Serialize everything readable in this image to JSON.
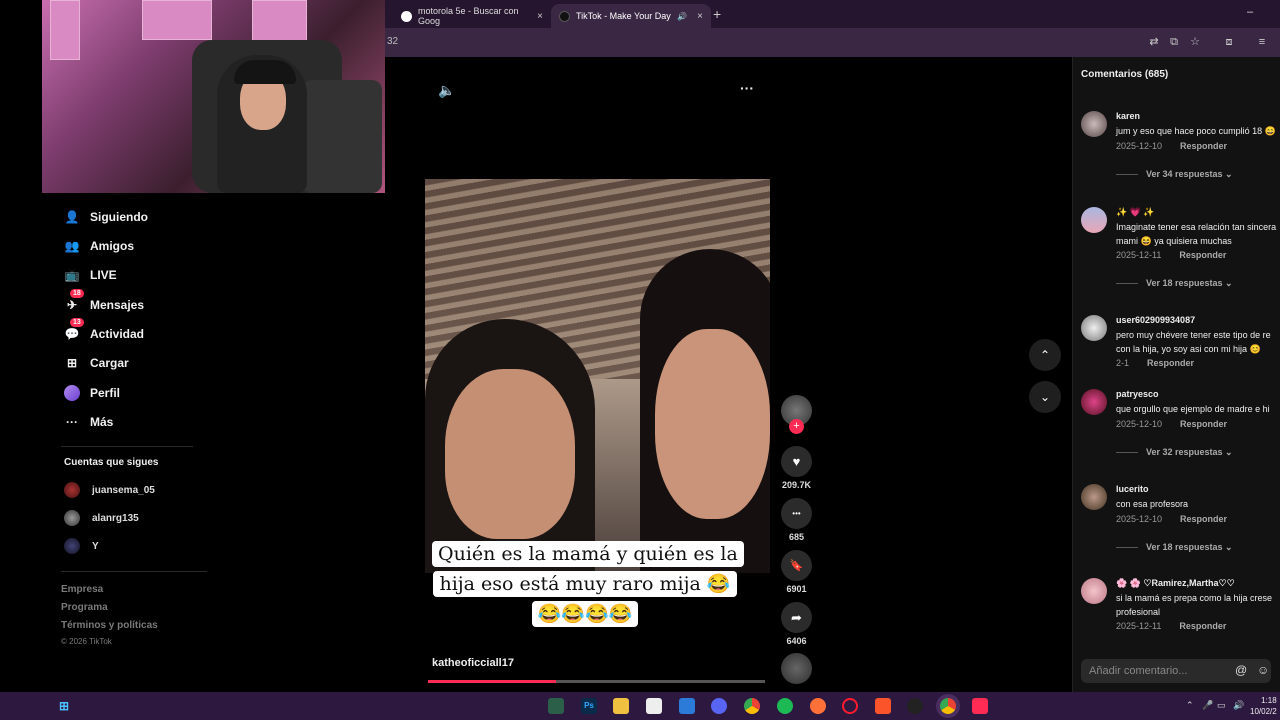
{
  "browser": {
    "tabs": [
      {
        "title": "motorola 5e - Buscar con Goog",
        "close": "×"
      },
      {
        "title": "TikTok - Make Your Day",
        "close": "×",
        "audio": "🔊"
      }
    ],
    "new_tab": "+",
    "url": "32",
    "window_controls": {
      "minimize": "–",
      "maximize": "▢"
    }
  },
  "sidebar": {
    "nav": [
      {
        "label": "Siguiendo",
        "icon": "user-following-icon",
        "glyph": "👤"
      },
      {
        "label": "Amigos",
        "icon": "friends-icon",
        "glyph": "👥"
      },
      {
        "label": "LIVE",
        "icon": "live-icon",
        "glyph": "📺"
      },
      {
        "label": "Mensajes",
        "icon": "messages-icon",
        "glyph": "✈",
        "badge": "18"
      },
      {
        "label": "Actividad",
        "icon": "activity-icon",
        "glyph": "💬",
        "badge": "13"
      },
      {
        "label": "Cargar",
        "icon": "upload-icon",
        "glyph": "⊞"
      },
      {
        "label": "Perfil",
        "icon": "profile-icon",
        "glyph": ""
      },
      {
        "label": "Más",
        "icon": "more-icon",
        "glyph": "···"
      }
    ],
    "following_title": "Cuentas que sigues",
    "following": [
      {
        "name": "juansema_05"
      },
      {
        "name": "alanrg135"
      },
      {
        "name": "Y"
      }
    ],
    "footer": [
      "Empresa",
      "Programa",
      "Términos y políticas",
      "© 2026 TikTok"
    ]
  },
  "video": {
    "caption": "Quién es la mamá y quién es la hija eso está muy raro mija 😂😂😂😂😂",
    "author": "katheoficciall17",
    "progress": 0.38,
    "volume_icon": "🔈",
    "menu_icon": "···"
  },
  "actions": {
    "likes": "209.7K",
    "comments": "685",
    "saves": "6901",
    "shares": "6406",
    "follow": "+",
    "like_glyph": "♥",
    "comment_glyph": "•••",
    "save_glyph": "🔖",
    "share_glyph": "➦",
    "up_glyph": "⌃",
    "down_glyph": "⌄"
  },
  "comments": {
    "title": "Comentarios (685)",
    "items": [
      {
        "user": "karen",
        "text": "jum y eso que hace poco cumplió 18 😄",
        "date": "2025-12-10",
        "reply": "Responder",
        "more": "Ver 34 respuestas ⌄"
      },
      {
        "user": "✨ 💗 ✨",
        "text": "Imaginate tener esa relación tan sincera",
        "text2": "mami 😆  ya quisiera muchas",
        "date": "2025-12-11",
        "reply": "Responder",
        "more": "Ver 18 respuestas ⌄"
      },
      {
        "user": "user602909934087",
        "text": "pero muy chévere tener este tipo de re",
        "text2": "con la hija, yo soy asi con mi hija 😊",
        "date": "2-1",
        "reply": "Responder"
      },
      {
        "user": "patryesco",
        "text": "que orgullo que ejemplo de madre e hi",
        "date": "2025-12-10",
        "reply": "Responder",
        "more": "Ver 32 respuestas ⌄"
      },
      {
        "user": "lucerito",
        "text": "con esa profesora",
        "date": "2025-12-10",
        "reply": "Responder",
        "more": "Ver 18 respuestas ⌄"
      },
      {
        "user": "🌸 🌸 ♡Ramirez,Martha♡♡",
        "text": "si la mamá es prepa como la hija crese",
        "text2": "profesional",
        "date": "2025-12-11",
        "reply": "Responder"
      }
    ],
    "input_placeholder": "Añadir comentario...",
    "mention_icon": "@",
    "emoji_icon": "☺"
  },
  "taskbar": {
    "time": "1:18",
    "date": "10/02/2",
    "apps": [
      "Ps"
    ]
  },
  "colors": {
    "accent": "#fe2c55",
    "taskbar": "#2d1840",
    "browser_tabbar": "#26152f"
  }
}
